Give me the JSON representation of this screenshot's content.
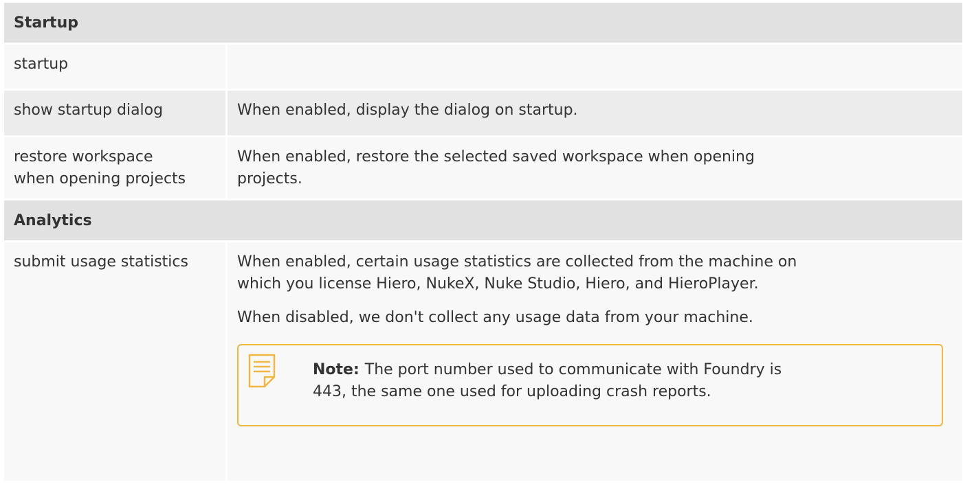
{
  "sections": [
    {
      "title": "Startup",
      "rows": [
        {
          "name": "startup",
          "desc": ""
        },
        {
          "name": "show startup dialog",
          "desc": "When enabled, display the dialog on startup."
        },
        {
          "name_line1": "restore workspace",
          "name_line2": "when opening projects",
          "desc_line1": "When enabled, restore the selected saved workspace when opening",
          "desc_line2": "projects."
        }
      ]
    },
    {
      "title": "Analytics",
      "rows": [
        {
          "name": "submit usage statistics",
          "desc_line1": "When enabled, certain usage statistics are collected from the machine on",
          "desc_line2": "which you license Hiero, NukeX, Nuke Studio, Hiero, and HieroPlayer.",
          "desc_para2": "When disabled, we don't collect any usage data from your machine.",
          "note": {
            "label": "Note:",
            "line1": "The port number used to communicate with Foundry is",
            "line2": "443, the same one used for uploading crash reports.",
            "icon": "note-icon",
            "border_color": "#f0b743"
          }
        }
      ]
    }
  ],
  "colors": {
    "section_bg": "#e1e1e1",
    "row_light": "#f8f8f8",
    "row_dark": "#ececec",
    "text": "#333333",
    "accent": "#f0b743"
  }
}
